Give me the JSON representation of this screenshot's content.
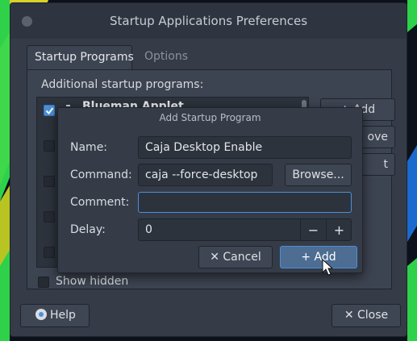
{
  "window": {
    "title": "Startup Applications Preferences",
    "tabs": [
      "Startup Programs",
      "Options"
    ],
    "section_label": "Additional startup programs:",
    "programs": [
      {
        "name": "Blueman Applet",
        "checked": true
      },
      {
        "name": "",
        "checked": false
      },
      {
        "name": "",
        "checked": false
      },
      {
        "name": "",
        "checked": false
      },
      {
        "name": "",
        "checked": false
      }
    ],
    "side_buttons": [
      "+ Add",
      "ove",
      "t"
    ],
    "show_hidden_label": "Show hidden",
    "help_label": "Help",
    "close_label": "✕ Close"
  },
  "dialog": {
    "title": "Add Startup Program",
    "name_label": "Name:",
    "name_value": "Caja Desktop Enable",
    "command_label": "Command:",
    "command_value": "caja --force-desktop",
    "browse_label": "Browse...",
    "comment_label": "Comment:",
    "comment_value": "",
    "delay_label": "Delay:",
    "delay_value": "0",
    "minus_label": "−",
    "plus_label": "+",
    "cancel_label": "✕ Cancel",
    "add_label": "+ Add"
  },
  "colors": {
    "accent": "#4a90d9",
    "window_bg": "#353c48",
    "desktop_green": "#2fd14a",
    "desktop_yellow": "#e8e02a"
  }
}
